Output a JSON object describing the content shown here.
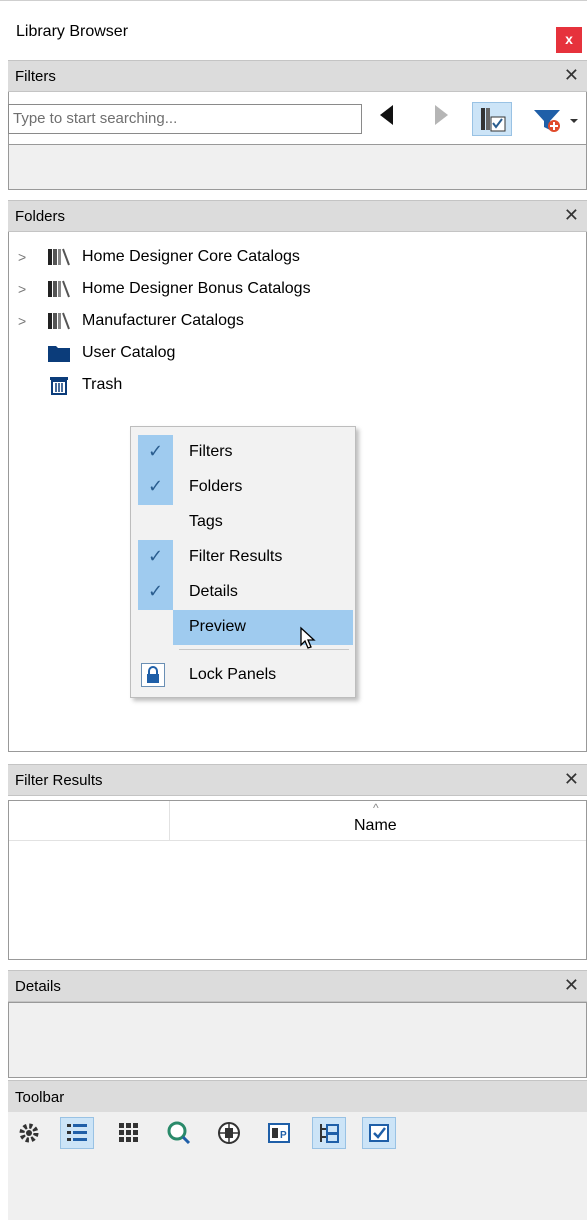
{
  "window": {
    "title": "Library Browser",
    "close_label": "x"
  },
  "filters_panel": {
    "title": "Filters",
    "close_label": "✕",
    "search_placeholder": "Type to start searching..."
  },
  "folders_panel": {
    "title": "Folders",
    "close_label": "✕",
    "items": [
      {
        "label": "Home Designer Core Catalogs",
        "icon": "catalog-books-icon",
        "expandable": true
      },
      {
        "label": "Home Designer Bonus Catalogs",
        "icon": "catalog-books-icon",
        "expandable": true
      },
      {
        "label": "Manufacturer Catalogs",
        "icon": "catalog-books-icon",
        "expandable": true
      },
      {
        "label": "User Catalog",
        "icon": "folder-icon",
        "expandable": false
      },
      {
        "label": "Trash",
        "icon": "trash-icon",
        "expandable": false
      }
    ]
  },
  "context_menu": {
    "items": [
      {
        "label": "Filters",
        "checked": true
      },
      {
        "label": "Folders",
        "checked": true
      },
      {
        "label": "Tags",
        "checked": false
      },
      {
        "label": "Filter Results",
        "checked": true
      },
      {
        "label": "Details",
        "checked": true
      },
      {
        "label": "Preview",
        "checked": false,
        "highlighted": true
      }
    ],
    "lock_label": "Lock Panels"
  },
  "results_panel": {
    "title": "Filter Results",
    "close_label": "✕",
    "column_name": "Name"
  },
  "details_panel": {
    "title": "Details",
    "close_label": "✕"
  },
  "toolbar_panel": {
    "title": "Toolbar",
    "buttons": [
      {
        "icon": "gear-icon",
        "active": false
      },
      {
        "icon": "list-view-icon",
        "active": true
      },
      {
        "icon": "grid-view-icon",
        "active": false
      },
      {
        "icon": "search-preview-icon",
        "active": false
      },
      {
        "icon": "web-catalog-icon",
        "active": false
      },
      {
        "icon": "properties-icon",
        "active": false
      },
      {
        "icon": "tree-view-icon",
        "active": true
      },
      {
        "icon": "checked-folder-icon",
        "active": true
      }
    ]
  },
  "colors": {
    "accent": "#cce4f7",
    "highlight": "#9fcbef",
    "close_red": "#e6323c"
  }
}
